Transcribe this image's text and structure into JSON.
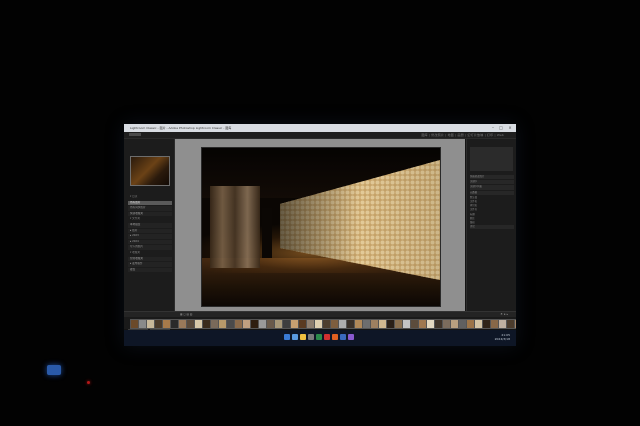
{
  "window": {
    "title": "Lightroom Classic - 图片 - Adobe Photoshop Lightroom Classic - 图库"
  },
  "module_picker": {
    "modules": [
      "图库",
      "修改照片",
      "地图",
      "画册",
      "幻灯片放映",
      "打印",
      "Web"
    ]
  },
  "left_panel": {
    "rows": [
      {
        "label": "▾ 目录",
        "style": "header"
      },
      {
        "label": "所有照片",
        "style": "selected"
      },
      {
        "label": "所有同步照片",
        "style": "box"
      },
      {
        "label": "快捷收藏夹",
        "style": "box"
      },
      {
        "label": "▾ 文件夹",
        "style": "header"
      },
      {
        "label": "本地磁盘",
        "style": "box"
      },
      {
        "label": "▸ 照片",
        "style": "box"
      },
      {
        "label": "▸ 2023",
        "style": "box"
      },
      {
        "label": "▸ 2024",
        "style": "box"
      },
      {
        "label": "导入的照片",
        "style": "box"
      },
      {
        "label": "▾ 收藏夹",
        "style": "header"
      },
      {
        "label": "智能收藏夹",
        "style": "box"
      },
      {
        "label": "▸ 发布服务",
        "style": "box"
      },
      {
        "label": "硬盘",
        "style": "box"
      }
    ]
  },
  "right_panel": {
    "rows": [
      {
        "label": "快速修改照片",
        "style": "box"
      },
      {
        "label": "关键字",
        "style": "box"
      },
      {
        "label": "关键字列表",
        "style": "box"
      },
      {
        "label": "元数据",
        "style": "box"
      },
      {
        "label": "默认值",
        "style": "plain"
      },
      {
        "label": "文件名",
        "style": "plain"
      },
      {
        "label": "拷贝名",
        "style": "plain"
      },
      {
        "label": "文件夹",
        "style": "plain"
      },
      {
        "label": "标题",
        "style": "plain"
      },
      {
        "label": "题注",
        "style": "plain"
      },
      {
        "label": "版权",
        "style": "plain"
      },
      {
        "label": "评论",
        "style": "box"
      }
    ]
  },
  "filmstrip": {
    "thumb_colors": [
      "#6b4a2a",
      "#8a8a8a",
      "#c8b89a",
      "#4a3a2a",
      "#a87a4a",
      "#2a2a2a",
      "#9a7a5a",
      "#5a4a3a",
      "#d8c8a8",
      "#3a2a1a",
      "#7a6a5a",
      "#b89a6a",
      "#4a4a4a",
      "#8a6a4a",
      "#c0a080",
      "#2e1e10",
      "#9a9a9a",
      "#6a5a4a",
      "#a89878",
      "#3e3e3e",
      "#c8a070",
      "#5a3a20",
      "#8e7e6e",
      "#e0d0b0",
      "#4e3e2e",
      "#7e5e3e",
      "#aeaeae",
      "#3a3028",
      "#b08858",
      "#6e6e6e",
      "#9e8060",
      "#d0b890",
      "#2a2018",
      "#8a7050",
      "#c4c4c4",
      "#5c4c3c",
      "#a07850",
      "#e4d8c0",
      "#403428",
      "#7c6c5c",
      "#b8a080",
      "#606060",
      "#9c7448",
      "#d4c4a4",
      "#302418",
      "#886848",
      "#c0b0a0",
      "#4c3c2c",
      "#a48464"
    ]
  },
  "taskbar": {
    "icon_colors": [
      "#3a7bd5",
      "#5a9ae0",
      "#f0c040",
      "#7a7a7a",
      "#2a8a4a",
      "#d03030",
      "#e06020",
      "#3a6ac0",
      "#8a5ad0"
    ],
    "time": "21:05",
    "date": "2024/3/18"
  }
}
